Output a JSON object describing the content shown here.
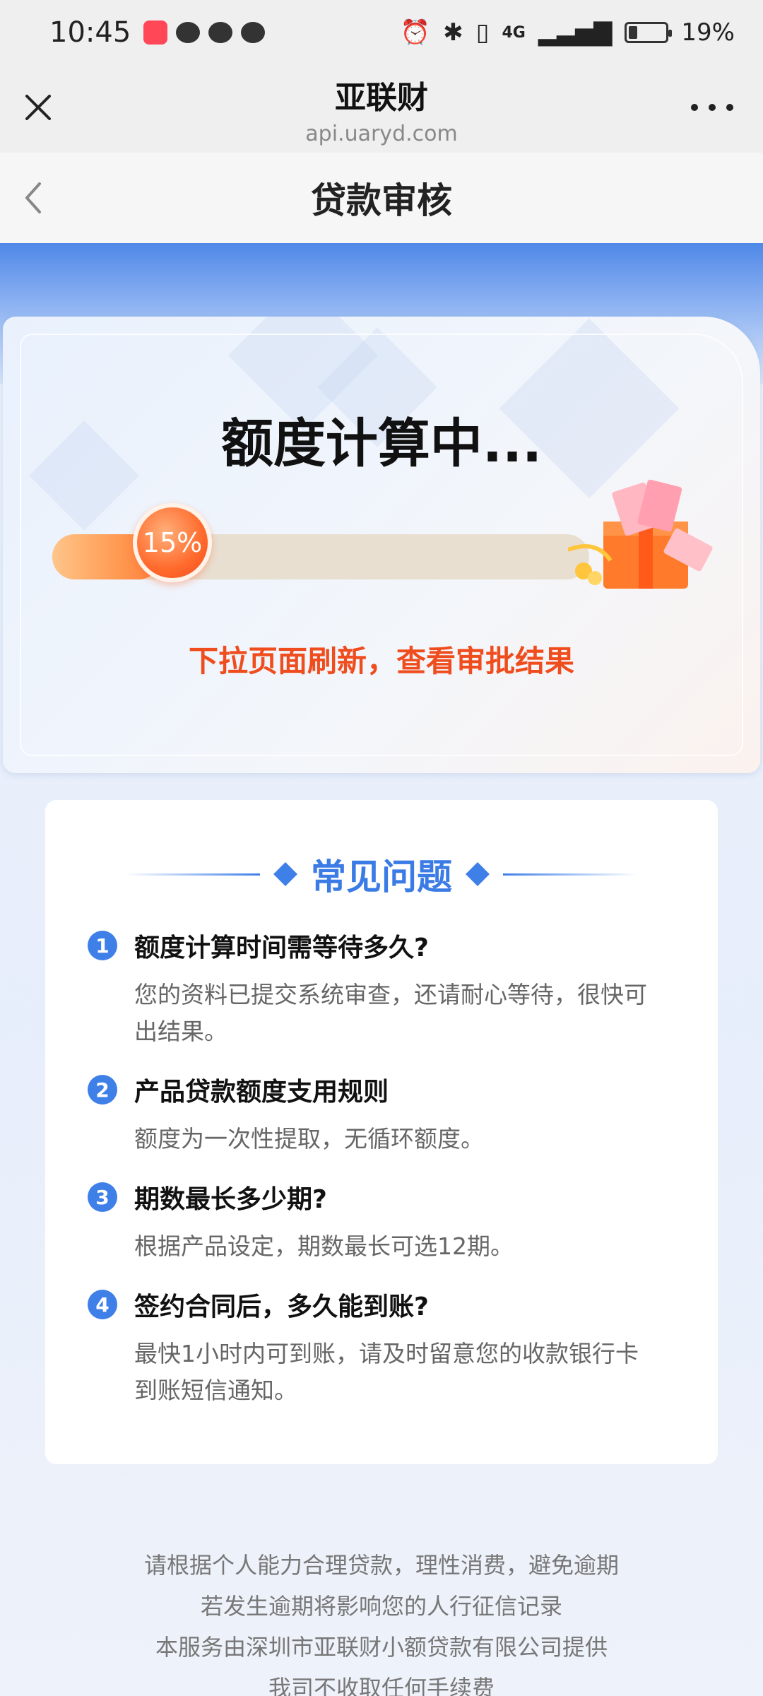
{
  "status_bar": {
    "time": "10:45",
    "battery_text": "19%",
    "network_label": "4G"
  },
  "browser": {
    "site_title": "亚联财",
    "site_url": "api.uaryd.com"
  },
  "page": {
    "title": "贷款审核"
  },
  "progress": {
    "title": "额度计算中...",
    "percent_text": "15%",
    "percent_value": 15,
    "hint": "下拉页面刷新，查看审批结果"
  },
  "faq": {
    "title": "常见问题",
    "items": [
      {
        "num": "1",
        "question": "额度计算时间需等待多久?",
        "answer_line1": "您的资料已提交系统审查，还请耐心等待，很快可",
        "answer_line2": "出结果。"
      },
      {
        "num": "2",
        "question": "产品贷款额度支用规则",
        "answer_line1": "额度为一次性提取，无循环额度。",
        "answer_line2": ""
      },
      {
        "num": "3",
        "question": "期数最长多少期?",
        "answer_line1": "根据产品设定，期数最长可选12期。",
        "answer_line2": ""
      },
      {
        "num": "4",
        "question": "签约合同后，多久能到账?",
        "answer_line1": "最快1小时内可到账，请及时留意您的收款银行卡",
        "answer_line2": "到账短信通知。"
      }
    ]
  },
  "footer": {
    "line1": "请根据个人能力合理贷款，理性消费，避免逾期",
    "line2": "若发生逾期将影响您的人行征信记录",
    "line3": "本服务由深圳市亚联财小额贷款有限公司提供",
    "line4": "我司不收取任何手续费"
  },
  "colors": {
    "accent_blue": "#3f7fe8",
    "accent_orange": "#ef4d1e"
  }
}
